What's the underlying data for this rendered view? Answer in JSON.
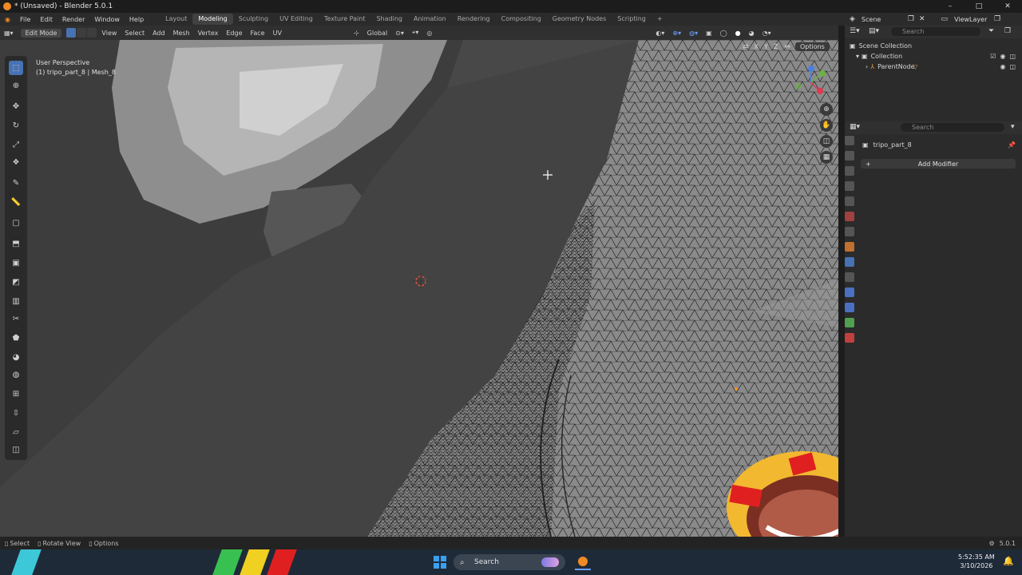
{
  "window": {
    "title": "* (Unsaved) - Blender 5.0.1",
    "controls": [
      "–",
      "□",
      "✕"
    ]
  },
  "menus": [
    "File",
    "Edit",
    "Render",
    "Window",
    "Help"
  ],
  "workspaces": [
    {
      "label": "Layout",
      "active": false
    },
    {
      "label": "Modeling",
      "active": true
    },
    {
      "label": "Sculpting",
      "active": false
    },
    {
      "label": "UV Editing",
      "active": false
    },
    {
      "label": "Texture Paint",
      "active": false
    },
    {
      "label": "Shading",
      "active": false
    },
    {
      "label": "Animation",
      "active": false
    },
    {
      "label": "Rendering",
      "active": false
    },
    {
      "label": "Compositing",
      "active": false
    },
    {
      "label": "Geometry Nodes",
      "active": false
    },
    {
      "label": "Scripting",
      "active": false
    }
  ],
  "add_workspace": "+",
  "scene": {
    "label": "Scene",
    "view_layer": "ViewLayer"
  },
  "viewport_header": {
    "mode": "Edit Mode",
    "menus": [
      "View",
      "Select",
      "Add",
      "Mesh",
      "Vertex",
      "Edge",
      "Face",
      "UV"
    ],
    "transform_orientation": "Global",
    "options_label": "Options",
    "axes": [
      "X",
      "Y",
      "Z"
    ]
  },
  "viewport": {
    "perspective_label": "User Perspective",
    "object_label": "(1) tripo_part_8 | Mesh_8"
  },
  "outliner": {
    "search_placeholder": "Search",
    "title": "Scene Collection",
    "items": [
      {
        "label": "Collection"
      },
      {
        "label": "ParentNode"
      }
    ]
  },
  "properties": {
    "search_placeholder": "Search",
    "object_name": "tripo_part_8",
    "add_modifier": "Add Modifier"
  },
  "statusbar": {
    "select": "Select",
    "rotate": "Rotate View",
    "options": "Options",
    "version": "5.0.1"
  },
  "taskbar": {
    "search": "Search",
    "time": "5:52:35 AM",
    "date": "3/10/2026"
  },
  "colors": {
    "accent": "#4772b3",
    "active_tool": "#4772b3",
    "wire": "#151515",
    "mesh_dark": "#3e3e3e",
    "mesh_light": "#8a8a8a",
    "origin": "#ff8c20"
  }
}
